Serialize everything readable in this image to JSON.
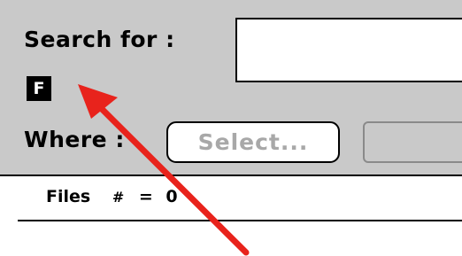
{
  "search": {
    "label": "Search for :",
    "value": "",
    "badge": "F"
  },
  "where": {
    "label": "Where :",
    "select_label": "Select..."
  },
  "results": {
    "files_label": "Files",
    "count_symbol": "#",
    "equals": "=",
    "count": "0"
  },
  "annotation": {
    "arrow_color": "#e8231c",
    "arrow_icon": "red-pointer-arrow"
  }
}
